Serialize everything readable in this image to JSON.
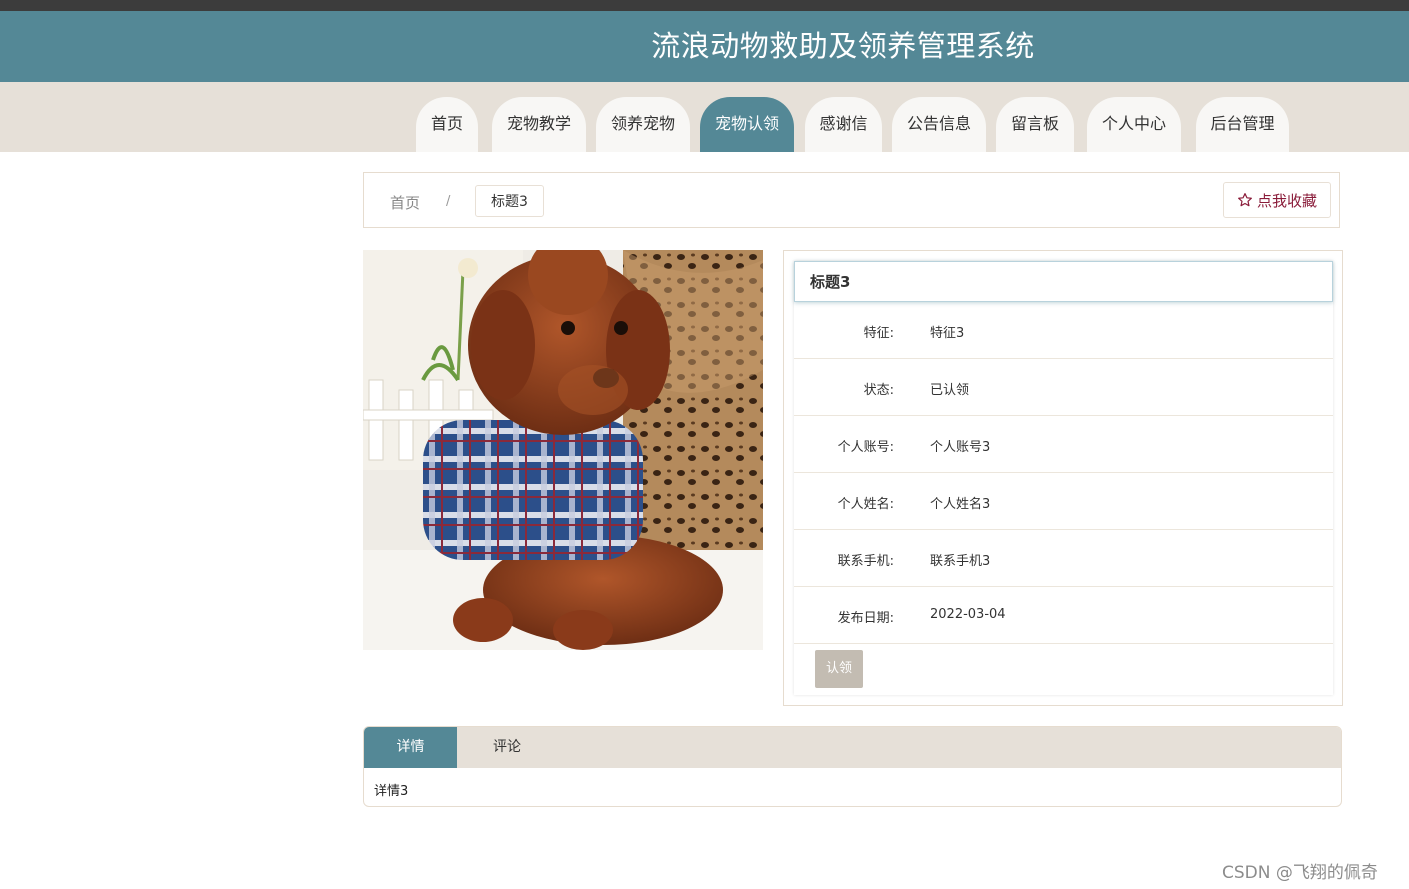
{
  "header": {
    "title": "流浪动物救助及领养管理系统"
  },
  "nav": {
    "items": [
      {
        "label": "首页",
        "active": false
      },
      {
        "label": "宠物教学",
        "active": false
      },
      {
        "label": "领养宠物",
        "active": false
      },
      {
        "label": "宠物认领",
        "active": true
      },
      {
        "label": "感谢信",
        "active": false
      },
      {
        "label": "公告信息",
        "active": false
      },
      {
        "label": "留言板",
        "active": false
      },
      {
        "label": "个人中心",
        "active": false
      },
      {
        "label": "后台管理",
        "active": false
      }
    ]
  },
  "breadcrumb": {
    "home": "首页",
    "separator": "/",
    "current": "标题3"
  },
  "favorite": {
    "icon": "star-outline-icon",
    "label": "点我收藏"
  },
  "photo": {
    "alt": "pet-photo"
  },
  "info": {
    "title": "标题3",
    "rows": [
      {
        "label": "特征:",
        "value": "特征3"
      },
      {
        "label": "状态:",
        "value": "已认领"
      },
      {
        "label": "个人账号:",
        "value": "个人账号3"
      },
      {
        "label": "个人姓名:",
        "value": "个人姓名3"
      },
      {
        "label": "联系手机:",
        "value": "联系手机3"
      },
      {
        "label": "发布日期:",
        "value": "2022-03-04"
      }
    ],
    "claim_label": "认领"
  },
  "detail_tabs": {
    "tabs": [
      {
        "label": "详情",
        "active": true
      },
      {
        "label": "评论",
        "active": false
      }
    ],
    "content": "详情3"
  },
  "watermark": "CSDN @飞翔的佩奇",
  "colors": {
    "primary": "#548896",
    "nav_bg": "#e6e0d8",
    "favorite": "#8a1c3a",
    "button_disabled": "#c3bcb2"
  }
}
